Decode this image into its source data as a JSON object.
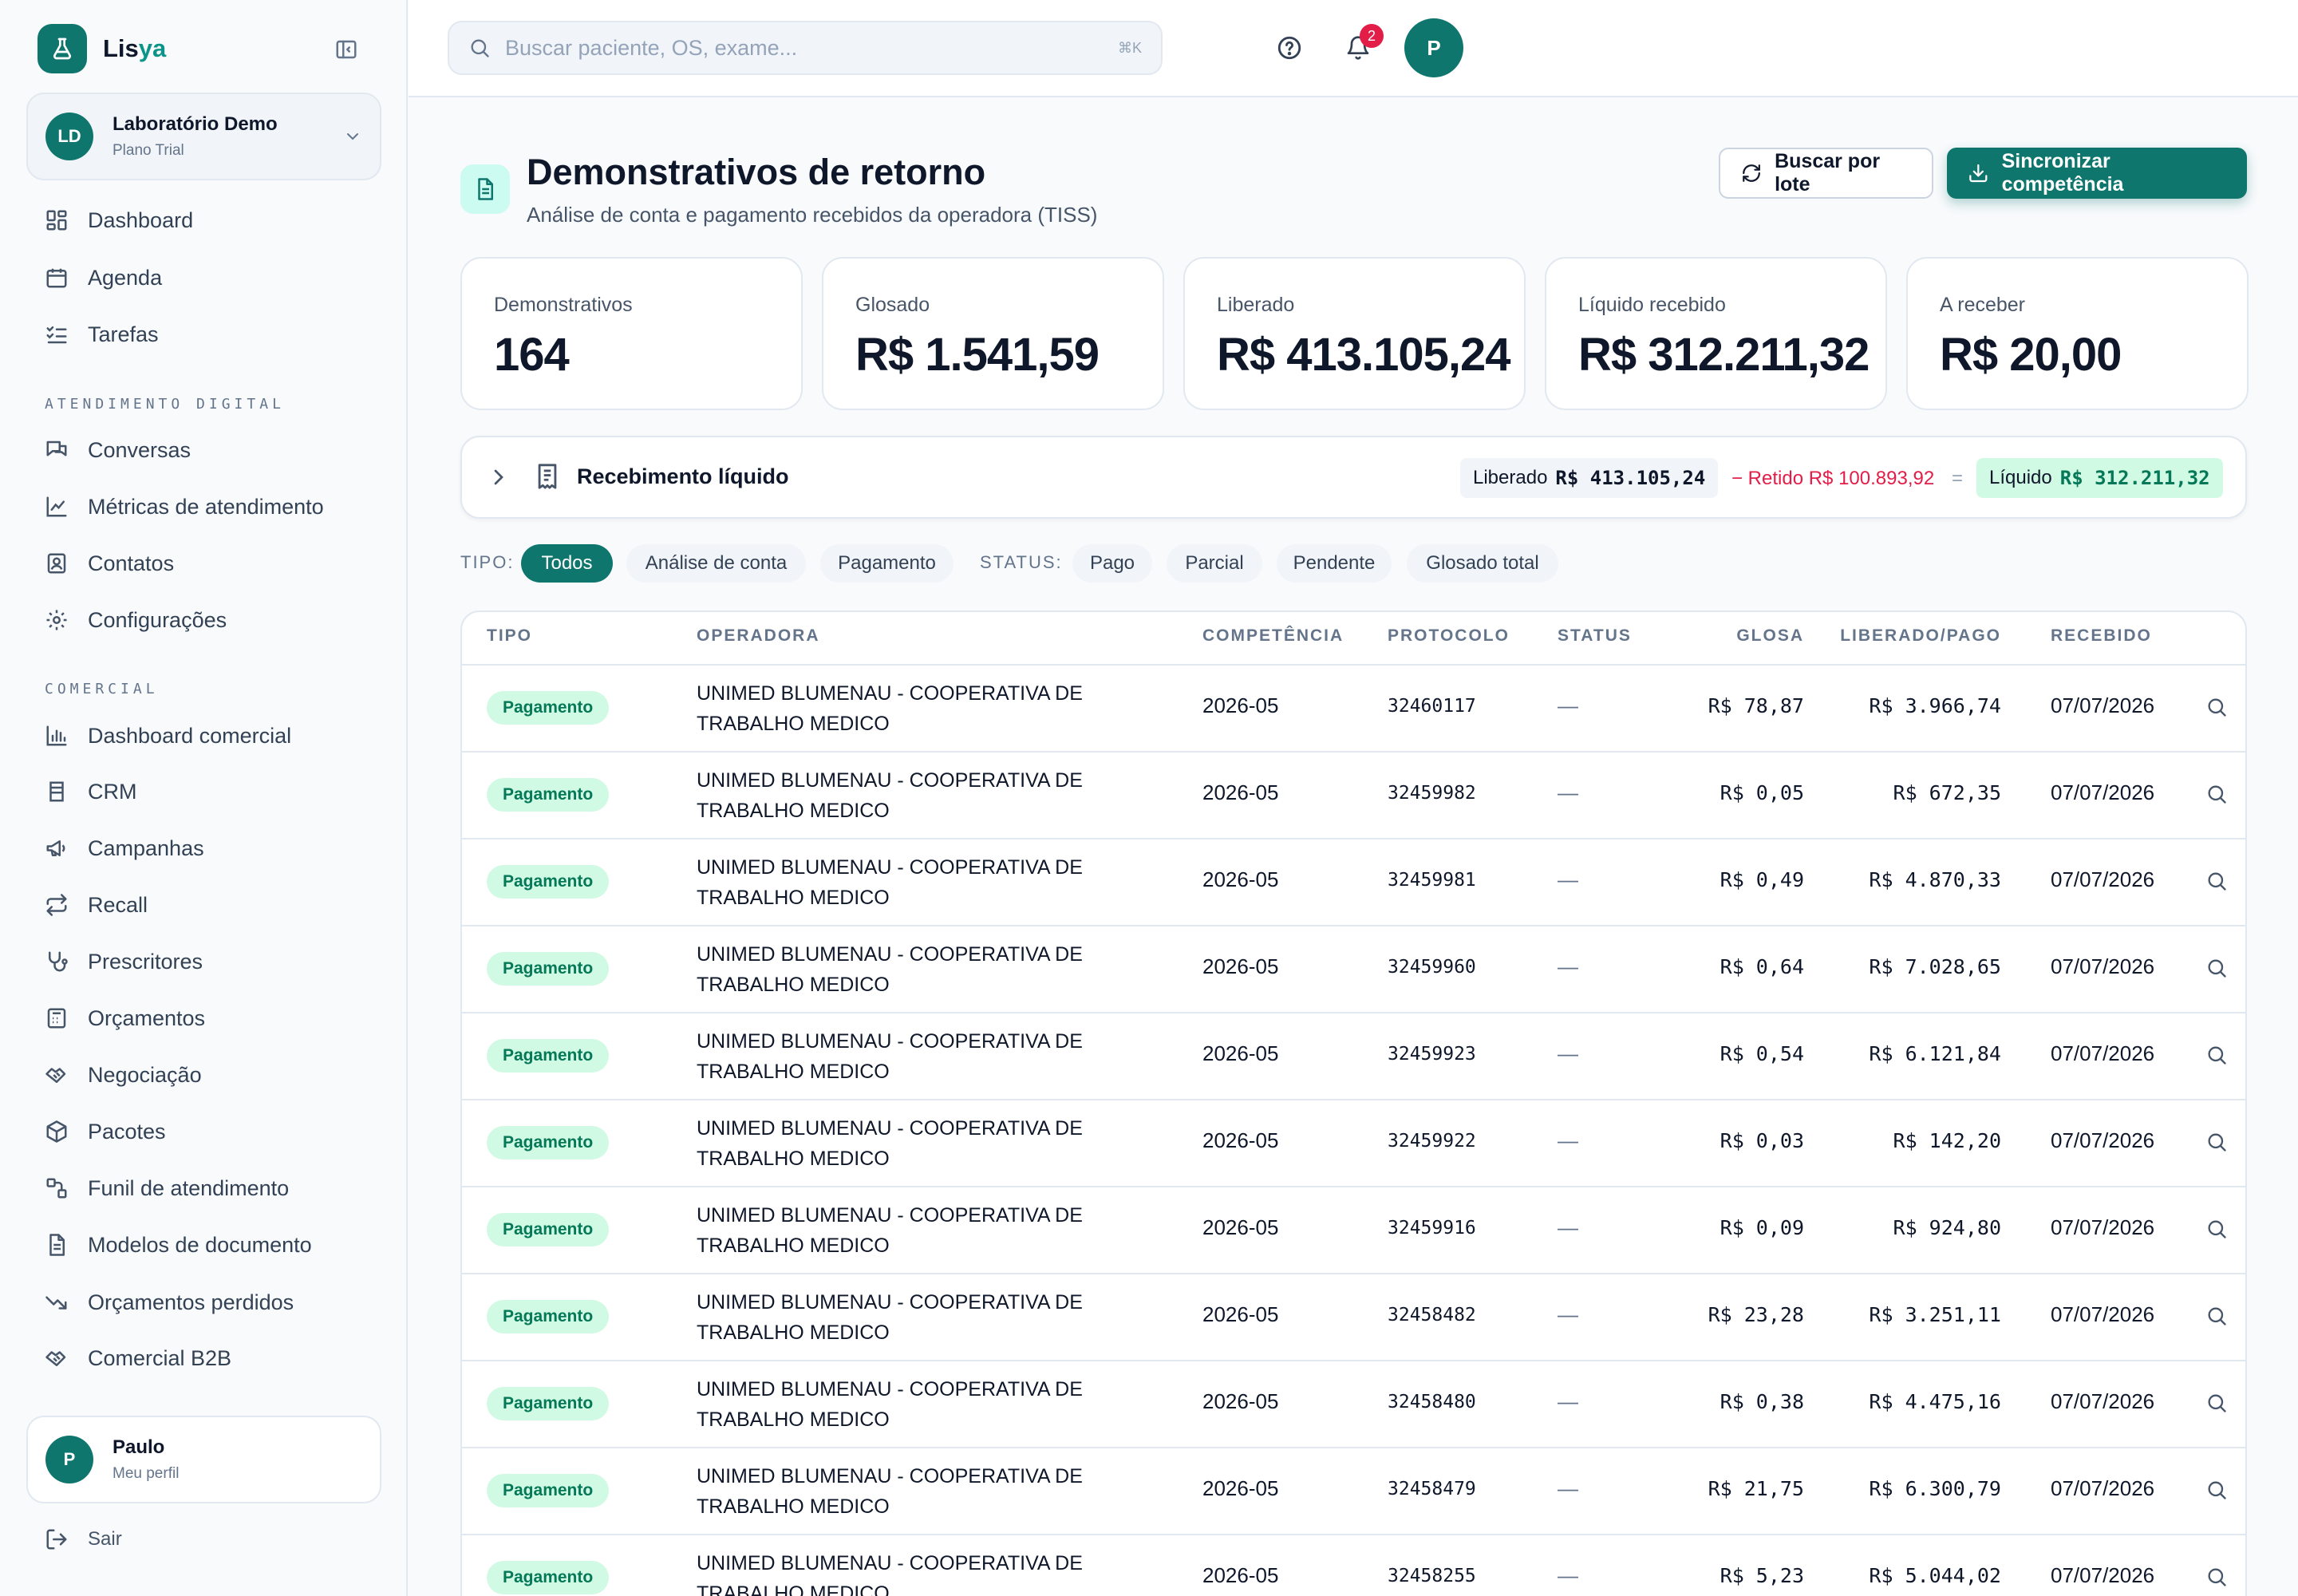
{
  "brand": {
    "part1": "Lis",
    "part2": "ya"
  },
  "org": {
    "initials": "LD",
    "name": "Laboratório Demo",
    "plan": "Plano Trial"
  },
  "nav": {
    "main": [
      {
        "label": "Dashboard",
        "icon": "dashboard-icon"
      },
      {
        "label": "Agenda",
        "icon": "calendar-icon"
      },
      {
        "label": "Tarefas",
        "icon": "tasks-icon"
      }
    ],
    "section_atendimento": "ATENDIMENTO DIGITAL",
    "atendimento": [
      {
        "label": "Conversas",
        "icon": "chat-icon"
      },
      {
        "label": "Métricas de atendimento",
        "icon": "line-chart-icon"
      },
      {
        "label": "Contatos",
        "icon": "contacts-icon"
      },
      {
        "label": "Configurações",
        "icon": "gear-icon"
      }
    ],
    "section_comercial": "COMERCIAL",
    "comercial": [
      {
        "label": "Dashboard comercial",
        "icon": "bar-chart-icon"
      },
      {
        "label": "CRM",
        "icon": "crm-icon"
      },
      {
        "label": "Campanhas",
        "icon": "megaphone-icon"
      },
      {
        "label": "Recall",
        "icon": "repeat-icon"
      },
      {
        "label": "Prescritores",
        "icon": "stethoscope-icon"
      },
      {
        "label": "Orçamentos",
        "icon": "calculator-icon"
      },
      {
        "label": "Negociação",
        "icon": "handshake-icon"
      },
      {
        "label": "Pacotes",
        "icon": "package-icon"
      },
      {
        "label": "Funil de atendimento",
        "icon": "funnel-icon"
      },
      {
        "label": "Modelos de documento",
        "icon": "document-icon"
      },
      {
        "label": "Orçamentos perdidos",
        "icon": "trend-down-icon"
      },
      {
        "label": "Comercial B2B",
        "icon": "handshake-icon"
      }
    ]
  },
  "profile": {
    "initial": "P",
    "name": "Paulo",
    "sub": "Meu perfil"
  },
  "logout_label": "Sair",
  "topbar": {
    "search_placeholder": "Buscar paciente, OS, exame...",
    "search_shortcut": "⌘K",
    "notif_count": "2",
    "user_initial": "P"
  },
  "header": {
    "title": "Demonstrativos de retorno",
    "subtitle": "Análise de conta e pagamento recebidos da operadora (TISS)",
    "btn_lote": "Buscar por lote",
    "btn_sync": "Sincronizar competência"
  },
  "stats": [
    {
      "label": "Demonstrativos",
      "value": "164"
    },
    {
      "label": "Glosado",
      "value": "R$ 1.541,59"
    },
    {
      "label": "Liberado",
      "value": "R$ 413.105,24"
    },
    {
      "label": "Líquido recebido",
      "value": "R$ 312.211,32"
    },
    {
      "label": "A receber",
      "value": "R$ 20,00"
    }
  ],
  "receipt": {
    "title": "Recebimento líquido",
    "liberado_label": "Liberado",
    "liberado_value": "R$ 413.105,24",
    "retido": "− Retido R$ 100.893,92",
    "equals": "=",
    "liquido_label": "Líquido",
    "liquido_value": "R$ 312.211,32"
  },
  "filters": {
    "tipo_label": "TIPO:",
    "tipo": [
      "Todos",
      "Análise de conta",
      "Pagamento"
    ],
    "status_label": "STATUS:",
    "status": [
      "Pago",
      "Parcial",
      "Pendente",
      "Glosado total"
    ]
  },
  "table": {
    "headers": [
      "TIPO",
      "OPERADORA",
      "COMPETÊNCIA",
      "PROTOCOLO",
      "STATUS",
      "GLOSA",
      "LIBERADO/PAGO",
      "RECEBIDO"
    ],
    "rows": [
      {
        "tipo": "Pagamento",
        "op1": "UNIMED BLUMENAU - COOPERATIVA DE",
        "op2": "TRABALHO MEDICO",
        "comp": "2026-05",
        "prot": "32460117",
        "status": "—",
        "glosa": "R$ 78,87",
        "lib": "R$ 3.966,74",
        "rec": "07/07/2026"
      },
      {
        "tipo": "Pagamento",
        "op1": "UNIMED BLUMENAU - COOPERATIVA DE",
        "op2": "TRABALHO MEDICO",
        "comp": "2026-05",
        "prot": "32459982",
        "status": "—",
        "glosa": "R$ 0,05",
        "lib": "R$ 672,35",
        "rec": "07/07/2026"
      },
      {
        "tipo": "Pagamento",
        "op1": "UNIMED BLUMENAU - COOPERATIVA DE",
        "op2": "TRABALHO MEDICO",
        "comp": "2026-05",
        "prot": "32459981",
        "status": "—",
        "glosa": "R$ 0,49",
        "lib": "R$ 4.870,33",
        "rec": "07/07/2026"
      },
      {
        "tipo": "Pagamento",
        "op1": "UNIMED BLUMENAU - COOPERATIVA DE",
        "op2": "TRABALHO MEDICO",
        "comp": "2026-05",
        "prot": "32459960",
        "status": "—",
        "glosa": "R$ 0,64",
        "lib": "R$ 7.028,65",
        "rec": "07/07/2026"
      },
      {
        "tipo": "Pagamento",
        "op1": "UNIMED BLUMENAU - COOPERATIVA DE",
        "op2": "TRABALHO MEDICO",
        "comp": "2026-05",
        "prot": "32459923",
        "status": "—",
        "glosa": "R$ 0,54",
        "lib": "R$ 6.121,84",
        "rec": "07/07/2026"
      },
      {
        "tipo": "Pagamento",
        "op1": "UNIMED BLUMENAU - COOPERATIVA DE",
        "op2": "TRABALHO MEDICO",
        "comp": "2026-05",
        "prot": "32459922",
        "status": "—",
        "glosa": "R$ 0,03",
        "lib": "R$ 142,20",
        "rec": "07/07/2026"
      },
      {
        "tipo": "Pagamento",
        "op1": "UNIMED BLUMENAU - COOPERATIVA DE",
        "op2": "TRABALHO MEDICO",
        "comp": "2026-05",
        "prot": "32459916",
        "status": "—",
        "glosa": "R$ 0,09",
        "lib": "R$ 924,80",
        "rec": "07/07/2026"
      },
      {
        "tipo": "Pagamento",
        "op1": "UNIMED BLUMENAU - COOPERATIVA DE",
        "op2": "TRABALHO MEDICO",
        "comp": "2026-05",
        "prot": "32458482",
        "status": "—",
        "glosa": "R$ 23,28",
        "lib": "R$ 3.251,11",
        "rec": "07/07/2026"
      },
      {
        "tipo": "Pagamento",
        "op1": "UNIMED BLUMENAU - COOPERATIVA DE",
        "op2": "TRABALHO MEDICO",
        "comp": "2026-05",
        "prot": "32458480",
        "status": "—",
        "glosa": "R$ 0,38",
        "lib": "R$ 4.475,16",
        "rec": "07/07/2026"
      },
      {
        "tipo": "Pagamento",
        "op1": "UNIMED BLUMENAU - COOPERATIVA DE",
        "op2": "TRABALHO MEDICO",
        "comp": "2026-05",
        "prot": "32458479",
        "status": "—",
        "glosa": "R$ 21,75",
        "lib": "R$ 6.300,79",
        "rec": "07/07/2026"
      },
      {
        "tipo": "Pagamento",
        "op1": "UNIMED BLUMENAU - COOPERATIVA DE",
        "op2": "TRABALHO MEDICO",
        "comp": "2026-05",
        "prot": "32458255",
        "status": "—",
        "glosa": "R$ 5,23",
        "lib": "R$ 5.044,02",
        "rec": "07/07/2026"
      }
    ]
  }
}
